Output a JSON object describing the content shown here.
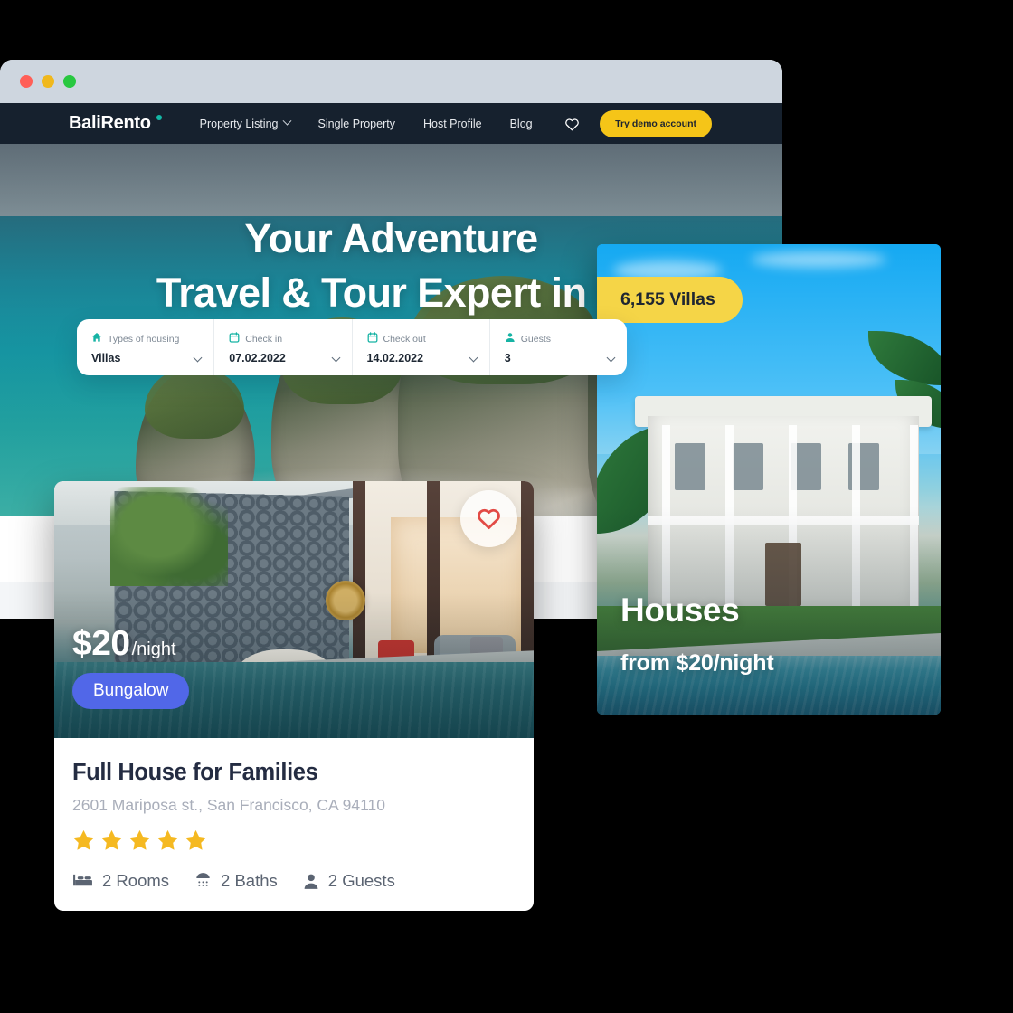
{
  "window": {
    "traffic_lights": [
      "close",
      "minimize",
      "maximize"
    ]
  },
  "nav": {
    "brand": "BaliRento",
    "links": [
      {
        "label": "Property Listing",
        "has_dropdown": true
      },
      {
        "label": "Single Property",
        "has_dropdown": false
      },
      {
        "label": "Host Profile",
        "has_dropdown": false
      },
      {
        "label": "Blog",
        "has_dropdown": false
      }
    ],
    "favorites_icon": "heart-icon",
    "cta_label": "Try demo account",
    "cta_color": "#f5c518",
    "bar_color": "#16212e"
  },
  "hero": {
    "title_line1": "Your Adventure",
    "title_line2": "Travel & Tour Expert in B"
  },
  "search": {
    "fields": [
      {
        "icon": "home-icon",
        "label": "Types of housing",
        "value": "Villas"
      },
      {
        "icon": "calendar-icon",
        "label": "Check in",
        "value": "07.02.2022"
      },
      {
        "icon": "calendar-icon",
        "label": "Check out",
        "value": "14.02.2022"
      },
      {
        "icon": "person-icon",
        "label": "Guests",
        "value": "3"
      }
    ],
    "icon_color": "#16b3a4"
  },
  "houses_card": {
    "badge": "6,155 Villas",
    "badge_color": "#f5d547",
    "title": "Houses",
    "subtitle": "from $20/night"
  },
  "property_card": {
    "favorite_icon": "heart-icon",
    "favorite_color": "#e24a45",
    "price_amount": "$20",
    "price_period": "/night",
    "tag": "Bungalow",
    "tag_color": "#5167e8",
    "title": "Full House for Families",
    "address": "2601 Mariposa st., San Francisco, CA 94110",
    "rating": 5,
    "star_color": "#f5b921",
    "features": [
      {
        "icon": "bed-icon",
        "label": "2 Rooms"
      },
      {
        "icon": "shower-icon",
        "label": "2 Baths"
      },
      {
        "icon": "person-icon",
        "label": "2 Guests"
      }
    ]
  }
}
